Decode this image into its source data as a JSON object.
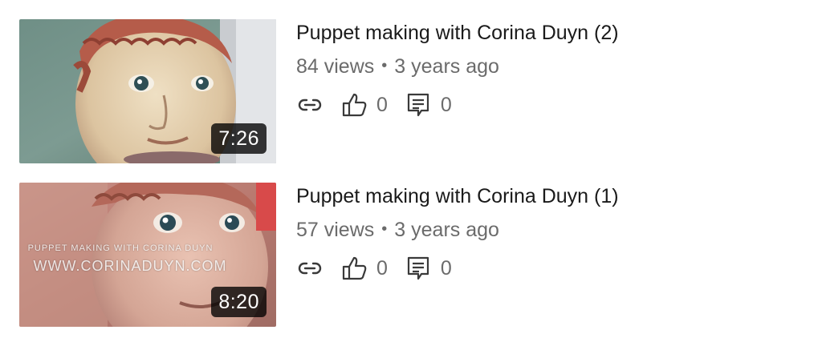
{
  "videos": [
    {
      "title": "Puppet making with Corina Duyn (2)",
      "views": "84 views",
      "age": "3 years ago",
      "duration": "7:26",
      "likes": "0",
      "comments": "0",
      "watermark_line1": "",
      "watermark_line2": ""
    },
    {
      "title": "Puppet making with Corina Duyn (1)",
      "views": "57 views",
      "age": "3 years ago",
      "duration": "8:20",
      "likes": "0",
      "comments": "0",
      "watermark_line1": "PUPPET MAKING WITH CORINA DUYN",
      "watermark_line2": "WWW.CORINADUYN.COM"
    }
  ],
  "separator": "•",
  "icons": {
    "share": "link-icon",
    "like": "thumbs-up-icon",
    "comment": "comment-icon"
  },
  "colors": {
    "text_primary": "#1a1a1a",
    "text_secondary": "#6b6b6b",
    "duration_bg": "#000000"
  }
}
